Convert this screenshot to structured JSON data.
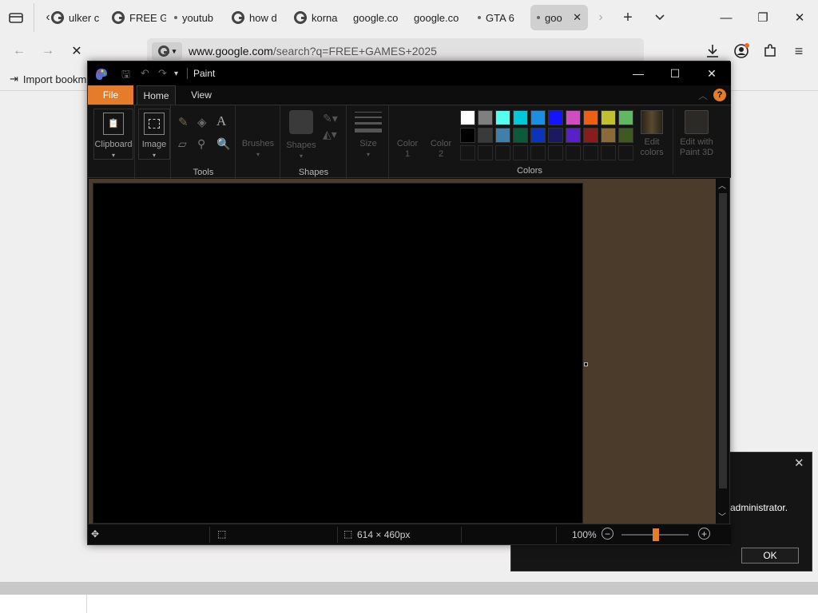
{
  "browser": {
    "tabs": [
      {
        "label": "ulker c",
        "icon": "google-icon"
      },
      {
        "label": "FREE G",
        "icon": "google-icon"
      },
      {
        "label": "youtub",
        "icon": "dot-icon"
      },
      {
        "label": "how d",
        "icon": "google-icon"
      },
      {
        "label": "korna",
        "icon": "google-icon"
      },
      {
        "label": "google.co",
        "icon": "none"
      },
      {
        "label": "google.co",
        "icon": "none"
      },
      {
        "label": "GTA 6",
        "icon": "dot-icon"
      },
      {
        "label": "goo",
        "icon": "dot-icon",
        "active": true
      }
    ],
    "url_domain": "www.google.com",
    "url_path": "/search?q=FREE+GAMES+2025",
    "bookmark": "Import bookm"
  },
  "paint": {
    "title": "Paint",
    "tabs": [
      "File",
      "Home",
      "View"
    ],
    "groups": {
      "clipboard": "Clipboard",
      "image": "Image",
      "tools": "Tools",
      "brushes": "Brushes",
      "shapes_btn": "Shapes",
      "shapes": "Shapes",
      "size": "Size",
      "color1_a": "Color",
      "color1_b": "1",
      "color2_a": "Color",
      "color2_b": "2",
      "colors": "Colors",
      "edit_colors_a": "Edit",
      "edit_colors_b": "colors",
      "paint3d_a": "Edit with",
      "paint3d_b": "Paint 3D"
    },
    "palette_row1": [
      "#ffffff",
      "#7f7f7f",
      "#55ffee",
      "#00c8d8",
      "#1d8fe0",
      "#1414ff",
      "#d04cc0",
      "#ee5e14",
      "#c0c030",
      "#60b860"
    ],
    "palette_row2": [
      "#000000",
      "#3a3a3a",
      "#3f7fa8",
      "#0c5a3c",
      "#0c34b8",
      "#1a1a60",
      "#5a20c8",
      "#8a1c1c",
      "#8a6a38",
      "#3f5a20"
    ],
    "status": {
      "dimensions": "614 × 460px",
      "zoom": "100%"
    }
  },
  "dialog": {
    "message": "administrator.",
    "ok": "OK"
  }
}
